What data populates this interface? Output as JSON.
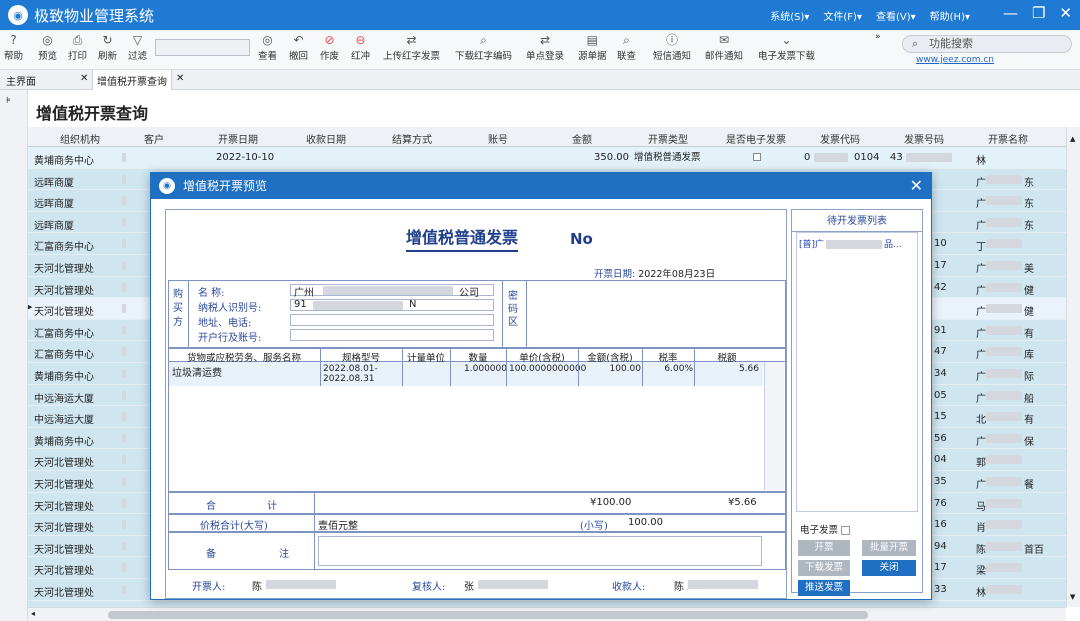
{
  "app": {
    "title": "极致物业管理系统",
    "menu": [
      "系统(S)▾",
      "文件(F)▾",
      "查看(V)▾",
      "帮助(H)▾"
    ]
  },
  "toolbar": {
    "items": [
      {
        "label": "帮助",
        "icon": "?"
      },
      {
        "label": "预览",
        "icon": "◎"
      },
      {
        "label": "打印",
        "icon": "⎙"
      },
      {
        "label": "刷新",
        "icon": "↻"
      },
      {
        "label": "过滤",
        "icon": "▽"
      },
      {
        "label": "查看",
        "icon": "◎"
      },
      {
        "label": "撤回",
        "icon": "↶"
      },
      {
        "label": "作废",
        "icon": "⊘"
      },
      {
        "label": "红冲",
        "icon": "⊖"
      },
      {
        "label": "上传红字发票",
        "icon": "⇄"
      },
      {
        "label": "下载红字编码",
        "icon": "⌕"
      },
      {
        "label": "单点登录",
        "icon": "⇄"
      },
      {
        "label": "源单据",
        "icon": "▤"
      },
      {
        "label": "联查",
        "icon": "⌕"
      },
      {
        "label": "短信通知",
        "icon": "ⓘ"
      },
      {
        "label": "邮件通知",
        "icon": "✉"
      },
      {
        "label": "电子发票下载",
        "icon": "⌄"
      }
    ],
    "search_label": "功能搜索",
    "website": "www.jeez.com.cn"
  },
  "tabs": [
    {
      "label": "主界面"
    },
    {
      "label": "增值税开票查询",
      "active": true
    }
  ],
  "page": {
    "title": "增值税开票查询"
  },
  "grid": {
    "columns": [
      "组织机构",
      "客户",
      "开票日期",
      "收款日期",
      "结算方式",
      "账号",
      "金额",
      "开票类型",
      "是否电子发票",
      "发票代码",
      "发票号码",
      "开票名称"
    ],
    "first_row": {
      "date": "2022-10-10",
      "amount": "350.00",
      "type": "增值税普通发票",
      "code_prefix": "0",
      "code_suffix": "0104",
      "num_prefix": "43",
      "name_prefix": "林"
    },
    "orgs": [
      "黄埔商务中心",
      "远晖商厦",
      "远晖商厦",
      "远晖商厦",
      "汇富商务中心",
      "天河北管理处",
      "天河北管理处",
      "天河北管理处",
      "汇富商务中心",
      "汇富商务中心",
      "黄埔商务中心",
      "中远海运大厦",
      "中远海运大厦",
      "黄埔商务中心",
      "天河北管理处",
      "天河北管理处",
      "天河北管理处",
      "天河北管理处",
      "天河北管理处",
      "天河北管理处",
      "天河北管理处"
    ],
    "right_num": [
      "",
      "",
      "",
      "",
      "10",
      "17",
      "42",
      "",
      "91",
      "47",
      "34",
      "05",
      "15",
      "56",
      "04",
      "35",
      "76",
      "16",
      "94",
      "17",
      "33"
    ],
    "right_name": [
      "",
      "广",
      "广",
      "广",
      "丁",
      "广",
      "广",
      "广",
      "广",
      "广",
      "广",
      "广",
      "北",
      "广",
      "郭",
      "广",
      "马",
      "肖",
      "陈",
      "梁",
      "林"
    ],
    "right_name2": [
      "",
      "东",
      "东",
      "东",
      "",
      "美",
      "健",
      "健",
      "有",
      "库",
      "际",
      "船",
      "有",
      "保",
      "",
      "餐",
      "",
      "",
      "首百",
      "",
      ""
    ]
  },
  "dialog": {
    "title": "增值税开票预览",
    "invoice": {
      "title": "增值税普通发票",
      "no": "No",
      "date_label": "开票日期:",
      "date": "2022年08月23日",
      "buyer_label": "购买方",
      "secret_label": "密码区",
      "name_label": "名 称:",
      "name_value_prefix": "广州",
      "name_value_suffix": "公司",
      "taxid_label": "纳税人识别号:",
      "taxid_prefix": "91",
      "taxid_suffix": "N",
      "addr_label": "地址、电话:",
      "bank_label": "开户行及账号:",
      "columns": [
        "货物或应税劳务、服务名称",
        "规格型号",
        "计量单位",
        "数量",
        "单价(含税)",
        "金额(含税)",
        "税率",
        "税额"
      ],
      "item": {
        "name": "垃圾清运费",
        "spec": "2022.08.01-2022.08.31",
        "unit": "",
        "qty": "1.000000",
        "price": "100.0000000000",
        "amount": "100.00",
        "rate": "6.00%",
        "tax": "5.66"
      },
      "total_label": "合 计",
      "total_amount": "¥100.00",
      "total_tax": "¥5.66",
      "sum_label": "价税合计(大写)",
      "sum_cn": "壹佰元整",
      "sum_small_label": "(小写)",
      "sum_small": "100.00",
      "remark_label": "备 注",
      "issuer_label": "开票人:",
      "issuer": "陈",
      "reviewer_label": "复核人:",
      "reviewer": "张",
      "payee_label": "收款人:",
      "payee": "陈"
    },
    "pending": {
      "title": "待开发票列表",
      "item": "[普]广",
      "item_suffix": "品...",
      "e_invoice_label": "电子发票",
      "buttons": {
        "open": "开票",
        "batch": "批量开票",
        "download": "下载发票",
        "close": "关闭",
        "push": "推送发票"
      }
    }
  }
}
